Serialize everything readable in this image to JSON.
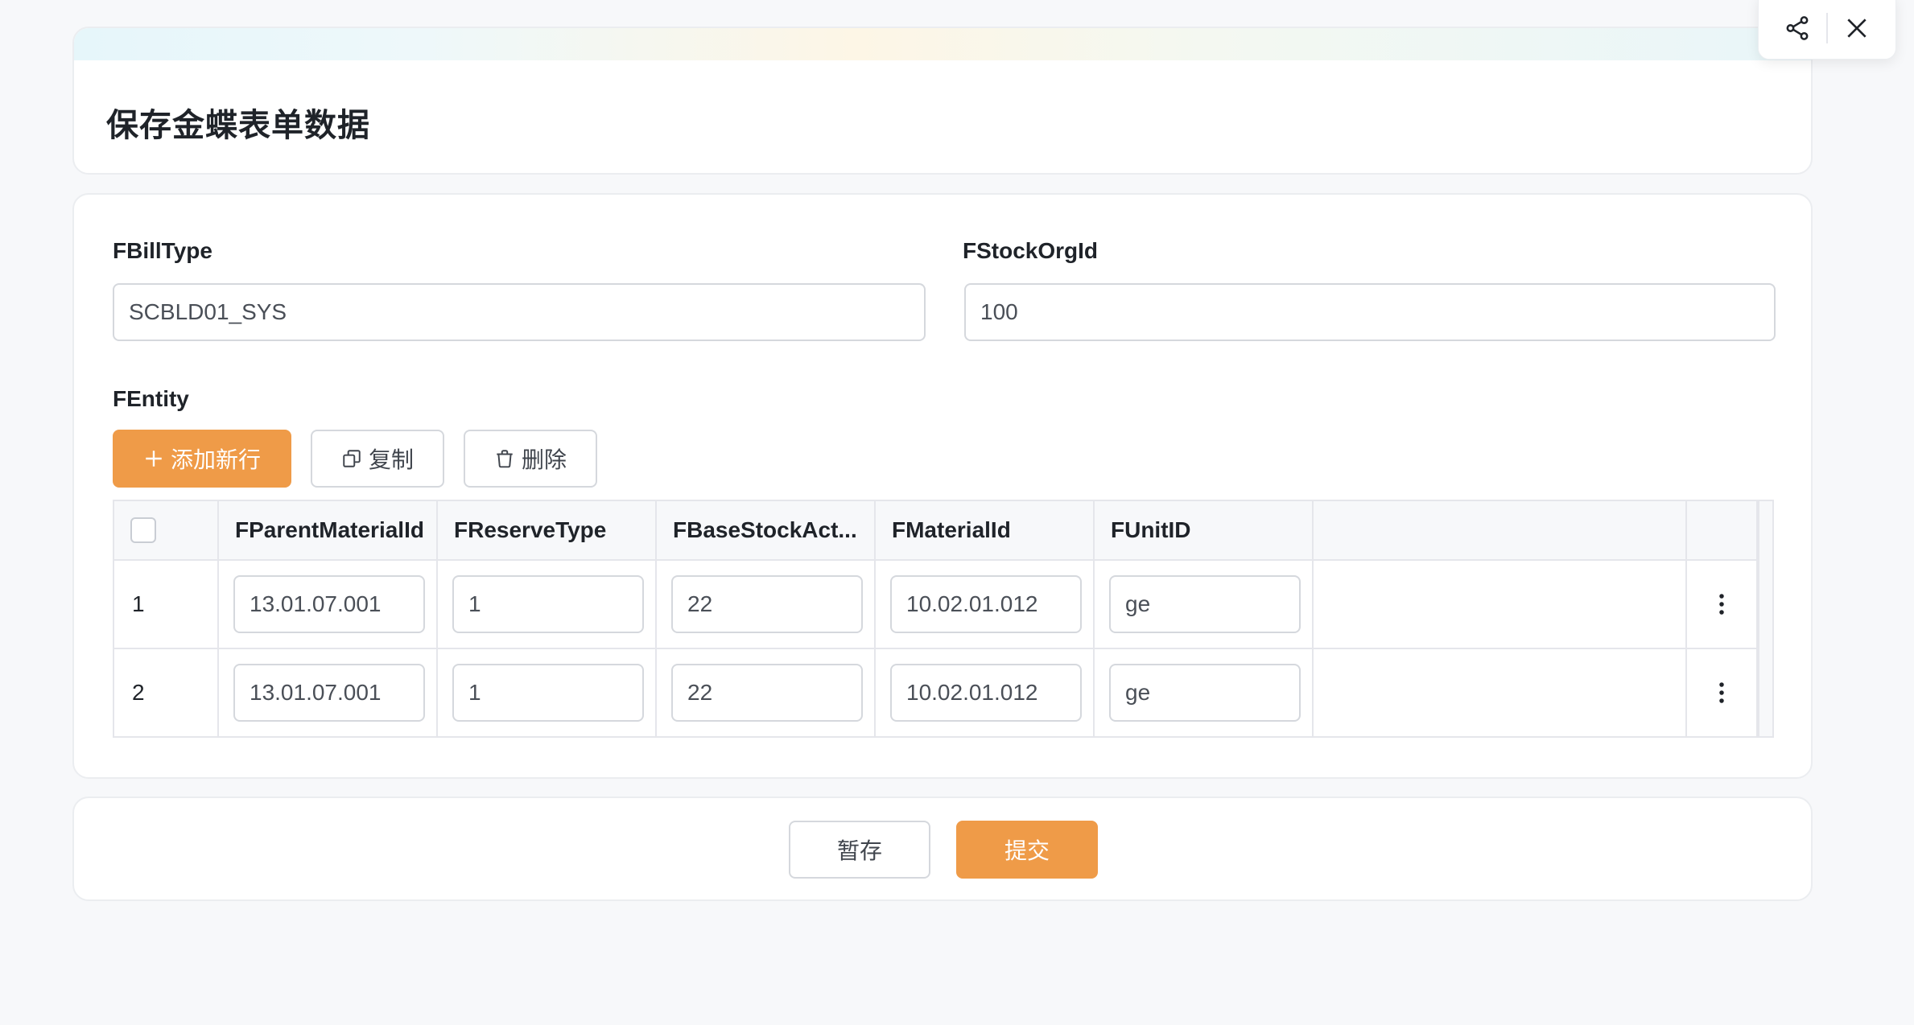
{
  "header": {
    "title": "保存金蝶表单数据"
  },
  "toolbar": {
    "share_icon": "share-icon",
    "close_icon": "close-icon"
  },
  "form": {
    "fbilltype": {
      "label": "FBillType",
      "value": "SCBLD01_SYS"
    },
    "fstockorgid": {
      "label": "FStockOrgId",
      "value": "100"
    },
    "fentity_label": "FEntity"
  },
  "entity_actions": {
    "add_label": "添加新行",
    "copy_label": "复制",
    "delete_label": "删除"
  },
  "table": {
    "columns": [
      "FParentMaterialId",
      "FReserveType",
      "FBaseStockAct...",
      "FMaterialId",
      "FUnitID"
    ],
    "rows": [
      {
        "index": "1",
        "cells": [
          "13.01.07.001",
          "1",
          "22",
          "10.02.01.012",
          "ge"
        ]
      },
      {
        "index": "2",
        "cells": [
          "13.01.07.001",
          "1",
          "22",
          "10.02.01.012",
          "ge"
        ]
      }
    ]
  },
  "footer": {
    "save_draft_label": "暂存",
    "submit_label": "提交"
  },
  "colors": {
    "accent": "#ef9b48",
    "border": "#d5d8dd",
    "background": "#f7f8fa"
  }
}
